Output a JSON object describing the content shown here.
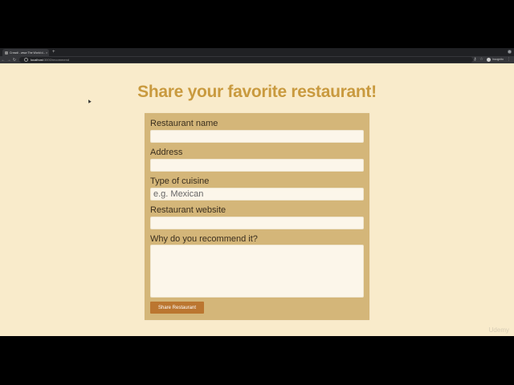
{
  "browser": {
    "tab_title": "Crowdi - www The World d...",
    "tab_close": "×",
    "new_tab": "+",
    "url_host": "localhost",
    "url_path": ":3000/recommend",
    "profile_label": "Incognito",
    "icons": [
      "back-icon",
      "forward-icon",
      "reload-icon",
      "lock-icon",
      "key-icon",
      "star-icon",
      "avatar",
      "menu-icon"
    ]
  },
  "page": {
    "title": "Share your favorite restaurant!"
  },
  "form": {
    "name_label": "Restaurant name",
    "name_value": "",
    "address_label": "Address",
    "address_value": "",
    "cuisine_label": "Type of cuisine",
    "cuisine_placeholder": "e.g. Mexican",
    "website_label": "Restaurant website",
    "website_value": "",
    "recommend_label": "Why do you recommend it?",
    "recommend_value": "",
    "submit_label": "Share Restaurant"
  },
  "watermark": "Udemy",
  "colors": {
    "page_background": "#f9ebcb",
    "title": "#c99a3f",
    "card": "#d4b679",
    "button": "#bb7630"
  }
}
